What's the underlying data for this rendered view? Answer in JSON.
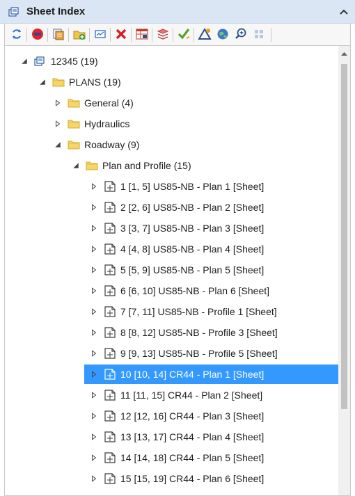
{
  "panel": {
    "title": "Sheet Index",
    "icons": {
      "title": "sheet-index-icon",
      "collapse": "chevron-up-icon"
    }
  },
  "toolbar": {
    "buttons": [
      "refresh-icon",
      "stop-icon",
      "sheet-stack-icon",
      "add-folder-icon",
      "properties-icon",
      "delete-icon",
      "table-icon",
      "layers-icon",
      "check-icon",
      "warning-icon",
      "globe-icon",
      "zoom-icon",
      "grid-icon"
    ]
  },
  "tree": {
    "root": {
      "label": "12345 (19)",
      "icon": "sheet-index-icon",
      "expanded": true
    },
    "plans": {
      "label": "PLANS (19)",
      "icon": "folder-icon",
      "expanded": true
    },
    "general": {
      "label": "General (4)",
      "icon": "folder-icon",
      "expanded": false
    },
    "hydraulics": {
      "label": "Hydraulics",
      "icon": "folder-icon",
      "expanded": false
    },
    "roadway": {
      "label": "Roadway (9)",
      "icon": "folder-icon",
      "expanded": true
    },
    "plan_profile": {
      "label": "Plan and Profile (15)",
      "icon": "folder-icon",
      "expanded": true
    },
    "sheets": [
      {
        "label": "1 [1, 5] US85-NB - Plan 1 [Sheet]",
        "selected": false
      },
      {
        "label": "2 [2, 6] US85-NB - Plan 2 [Sheet]",
        "selected": false
      },
      {
        "label": "3 [3, 7] US85-NB - Plan 3 [Sheet]",
        "selected": false
      },
      {
        "label": "4 [4, 8] US85-NB - Plan 4 [Sheet]",
        "selected": false
      },
      {
        "label": "5 [5, 9] US85-NB - Plan 5 [Sheet]",
        "selected": false
      },
      {
        "label": "6 [6, 10] US85-NB - Plan 6 [Sheet]",
        "selected": false
      },
      {
        "label": "7 [7, 11] US85-NB - Profile 1 [Sheet]",
        "selected": false
      },
      {
        "label": "8 [8, 12] US85-NB - Profile 3 [Sheet]",
        "selected": false
      },
      {
        "label": "9 [9, 13] US85-NB - Profile 5 [Sheet]",
        "selected": false
      },
      {
        "label": "10 [10, 14] CR44 - Plan 1 [Sheet]",
        "selected": true
      },
      {
        "label": "11 [11, 15] CR44 - Plan 2 [Sheet]",
        "selected": false
      },
      {
        "label": "12 [12, 16] CR44 - Plan 3 [Sheet]",
        "selected": false
      },
      {
        "label": "13 [13, 17] CR44 - Plan 4 [Sheet]",
        "selected": false
      },
      {
        "label": "14 [14, 18] CR44 - Plan 5 [Sheet]",
        "selected": false
      },
      {
        "label": "15 [15, 19] CR44 - Plan 6 [Sheet]",
        "selected": false
      }
    ]
  },
  "colors": {
    "selection": "#3399ff",
    "folder": "#f5d66b",
    "header": "#dbe6f4"
  }
}
